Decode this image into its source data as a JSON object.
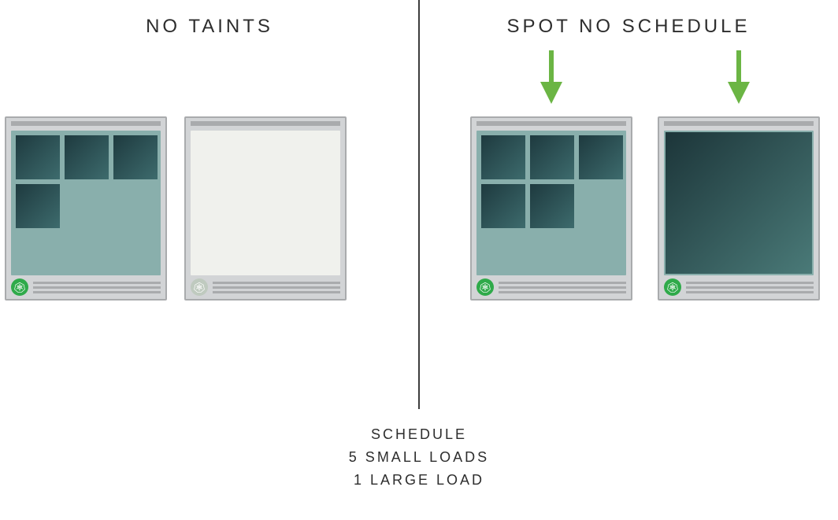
{
  "headers": {
    "left": "NO TAINTS",
    "right": "SPOT NO SCHEDULE"
  },
  "caption": {
    "line1": "SCHEDULE",
    "line2": "5 SMALL LOADS",
    "line3": "1 LARGE LOAD"
  },
  "icons": {
    "wheel_alt": "kubernetes-wheel"
  },
  "colors": {
    "arrow": "#6bb544"
  },
  "nodes": {
    "left_a": {
      "active": true,
      "pods": 4
    },
    "left_b": {
      "active": false,
      "pods": 0
    },
    "right_a": {
      "active": true,
      "pods": 5
    },
    "right_b": {
      "active": true,
      "big": true
    }
  }
}
